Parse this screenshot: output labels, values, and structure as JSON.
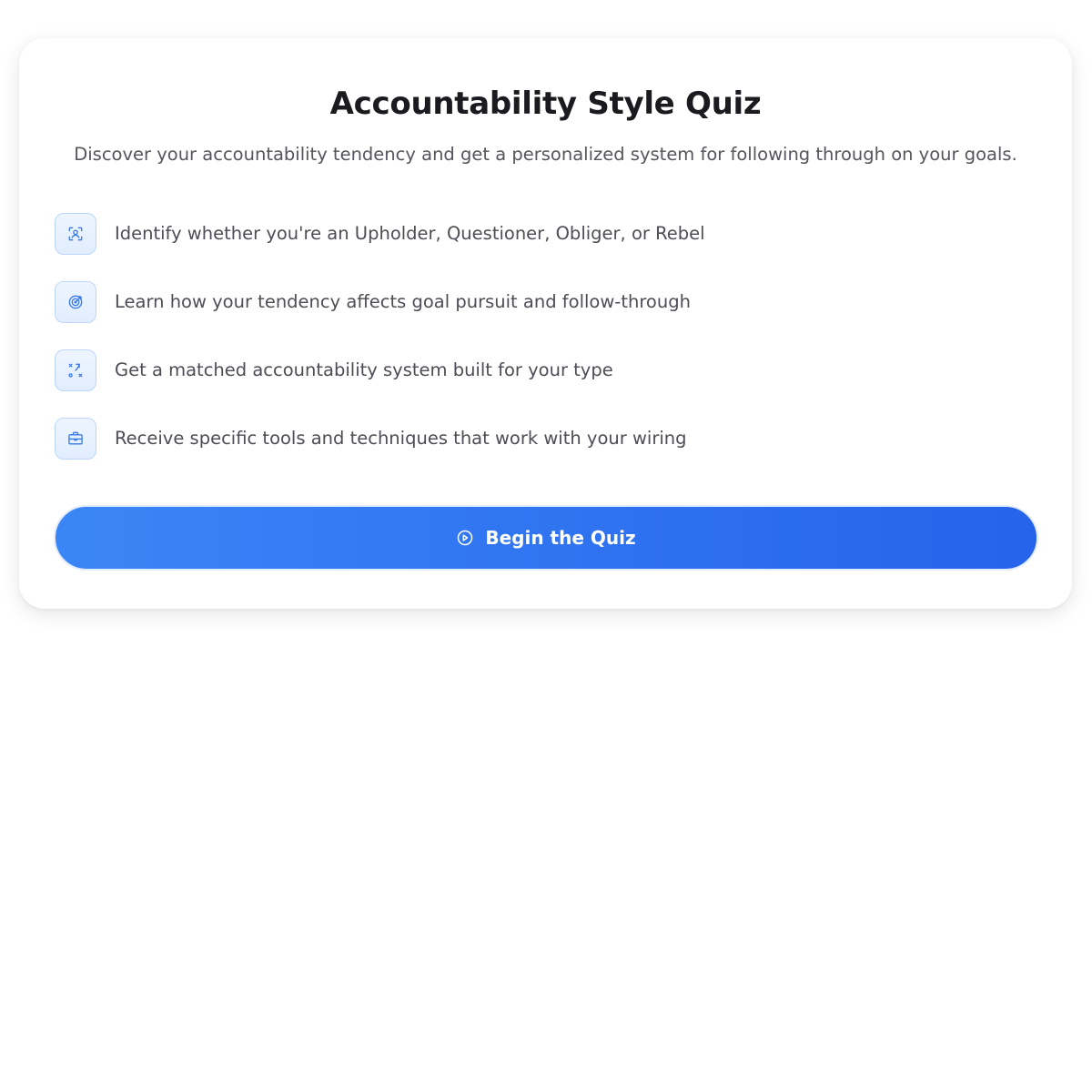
{
  "quiz": {
    "title": "Accountability Style Quiz",
    "subtitle": "Discover your accountability tendency and get a personalized system for following through on your goals.",
    "features": [
      {
        "icon": "person-scan-icon",
        "text": "Identify whether you're an Upholder, Questioner, Obliger, or Rebel"
      },
      {
        "icon": "target-icon",
        "text": "Learn how your tendency affects goal pursuit and follow-through"
      },
      {
        "icon": "strategy-icon",
        "text": "Get a matched accountability system built for your type"
      },
      {
        "icon": "briefcase-icon",
        "text": "Receive specific tools and techniques that work with your wiring"
      }
    ],
    "cta": {
      "label": "Begin the Quiz",
      "icon": "play-circle-icon"
    }
  },
  "colors": {
    "accent": "#2563eb",
    "accent_light": "#3b86f6",
    "icon_stroke": "#3b7be6",
    "icon_bg": "#e6f0ff",
    "title": "#1b1b1f",
    "body_text": "#4d4d56"
  }
}
